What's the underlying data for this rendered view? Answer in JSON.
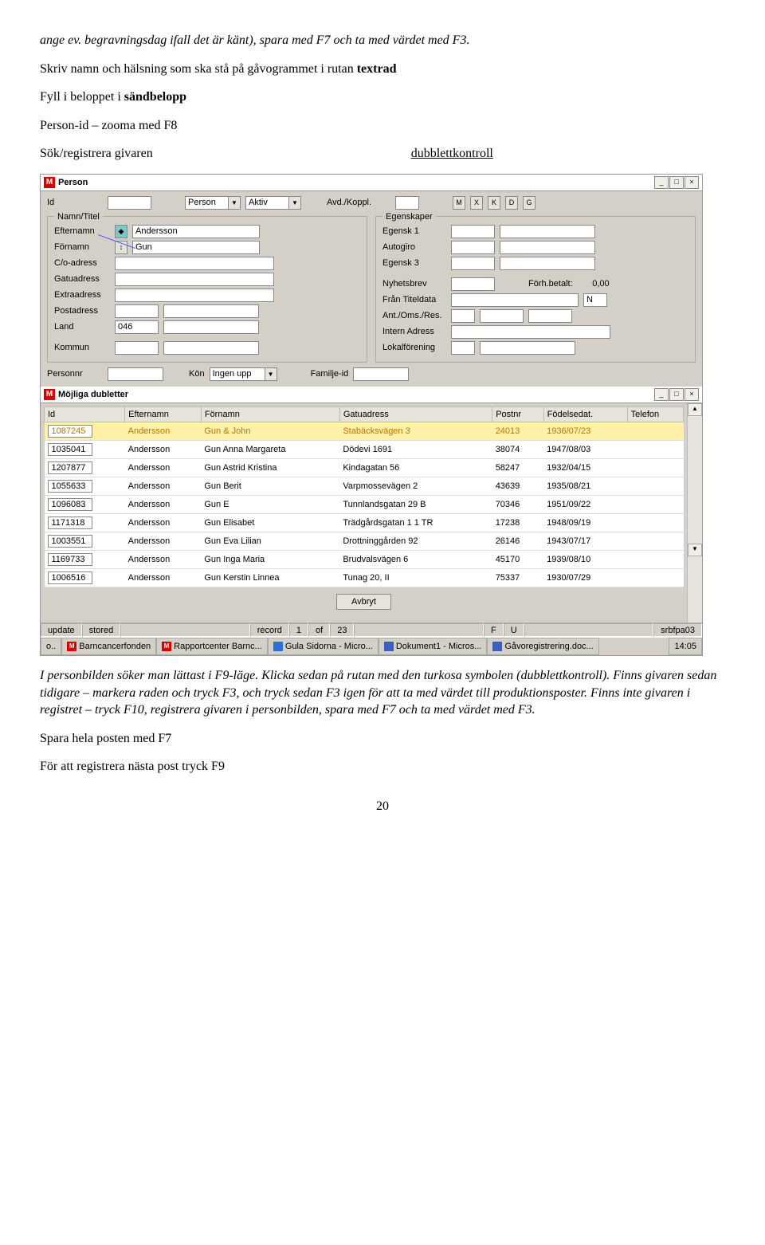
{
  "doc": {
    "p1": "ange ev. begravningsdag ifall det är känt), spara med F7 och ta med värdet med F3.",
    "p2_pre": "Skriv namn och hälsning som ska stå på gåvogrammet i rutan ",
    "p2_b": "textrad",
    "p3_pre": "Fyll i beloppet i ",
    "p3_b": "sändbelopp",
    "p4": "Person-id – zooma med F8",
    "p5": "Sök/registrera givaren",
    "dub_label": "dubblettkontroll",
    "p6": "I personbilden söker man lättast i F9-läge. Klicka sedan på rutan med den turkosa symbolen (dubblettkontroll). Finns givaren sedan tidigare – markera raden och tryck F3, och tryck sedan F3 igen för att ta med värdet till produktionsposter. Finns inte givaren i registret – tryck F10, registrera givaren i personbilden, spara med F7 och ta med värdet med F3.",
    "p7": "Spara hela posten med F7",
    "p8": "För att registrera nästa post tryck F9",
    "page_num": "20"
  },
  "win1": {
    "title": "Person",
    "id_lbl": "Id",
    "person_lbl": "Person",
    "aktiv_lbl": "Aktiv",
    "avd_lbl": "Avd./Koppl.",
    "namn_legend": "Namn/Titel",
    "egen_legend": "Egenskaper",
    "efternamn_lbl": "Efternamn",
    "efternamn_val": "Andersson",
    "fornamn_lbl": "Förnamn",
    "fornamn_val": "Gun",
    "co_lbl": "C/o-adress",
    "gatu_lbl": "Gatuadress",
    "extra_lbl": "Extraadress",
    "post_lbl": "Postadress",
    "land_lbl": "Land",
    "land_val": "046",
    "kommun_lbl": "Kommun",
    "eg1_lbl": "Egensk 1",
    "autog_lbl": "Autogiro",
    "eg3_lbl": "Egensk 3",
    "nyhets_lbl": "Nyhetsbrev",
    "forhb_lbl": "Förh.betalt:",
    "forhb_val": "0,00",
    "titel_lbl": "Från Titeldata",
    "titel_val": "N",
    "ant_lbl": "Ant./Oms./Res.",
    "intern_lbl": "Intern Adress",
    "lokal_lbl": "Lokalförening",
    "pnr_lbl": "Personnr",
    "kon_lbl": "Kön",
    "ingen_val": "Ingen upp",
    "fam_lbl": "Familje-id",
    "btn_m": "M",
    "btn_x": "X",
    "btn_k": "K",
    "btn_d": "D",
    "btn_g": "G"
  },
  "win2": {
    "title": "Möjliga dubletter",
    "col_id": "Id",
    "col_eft": "Efternamn",
    "col_for": "Förnamn",
    "col_gatu": "Gatuadress",
    "col_postnr": "Postnr",
    "col_fd": "Födelsedat.",
    "col_tel": "Telefon",
    "rows": [
      {
        "id": "1087245",
        "eft": "Andersson",
        "for": "Gun & John",
        "gatu": "Stabäcksvägen 3",
        "pnr": "24013",
        "fd": "1936/07/23",
        "tel": ""
      },
      {
        "id": "1035041",
        "eft": "Andersson",
        "for": "Gun Anna Margareta",
        "gatu": "Dödevi 1691",
        "pnr": "38074",
        "fd": "1947/08/03",
        "tel": ""
      },
      {
        "id": "1207877",
        "eft": "Andersson",
        "for": "Gun Astrid Kristina",
        "gatu": "Kindagatan 56",
        "pnr": "58247",
        "fd": "1932/04/15",
        "tel": ""
      },
      {
        "id": "1055633",
        "eft": "Andersson",
        "for": "Gun Berit",
        "gatu": "Varpmossevägen 2",
        "pnr": "43639",
        "fd": "1935/08/21",
        "tel": ""
      },
      {
        "id": "1096083",
        "eft": "Andersson",
        "for": "Gun E",
        "gatu": "Tunnlandsgatan 29 B",
        "pnr": "70346",
        "fd": "1951/09/22",
        "tel": ""
      },
      {
        "id": "1171318",
        "eft": "Andersson",
        "for": "Gun Elisabet",
        "gatu": "Trädgårdsgatan 1 1 TR",
        "pnr": "17238",
        "fd": "1948/09/19",
        "tel": ""
      },
      {
        "id": "1003551",
        "eft": "Andersson",
        "for": "Gun Eva Lilian",
        "gatu": "Drottninggården 92",
        "pnr": "26146",
        "fd": "1943/07/17",
        "tel": ""
      },
      {
        "id": "1169733",
        "eft": "Andersson",
        "for": "Gun Inga Maria",
        "gatu": "Brudvalsvägen 6",
        "pnr": "45170",
        "fd": "1939/08/10",
        "tel": ""
      },
      {
        "id": "1006516",
        "eft": "Andersson",
        "for": "Gun Kerstin Linnea",
        "gatu": "Tunag 20, II",
        "pnr": "75337",
        "fd": "1930/07/29",
        "tel": ""
      }
    ],
    "btn_avbryt": "Avbryt"
  },
  "status": {
    "update": "update",
    "stored": "stored",
    "record": "record",
    "rec_n": "1",
    "of": "of",
    "of_n": "23",
    "f": "F",
    "u": "U",
    "db": "srbfpa03"
  },
  "taskbar": {
    "t0": "o..",
    "t1": "Barncancerfonden",
    "t2": "Rapportcenter Barnc...",
    "t3": "Gula Sidorna - Micro...",
    "t4": "Dokument1 - Micros...",
    "t5": "Gåvoregistrering.doc...",
    "clock": "14:05"
  }
}
